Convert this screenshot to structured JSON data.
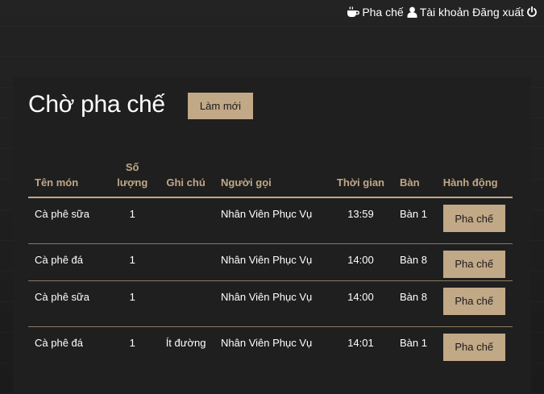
{
  "nav": {
    "barista_label": "Pha chế",
    "account_label": "Tài khoản",
    "logout_label": "Đăng xuất",
    "icons": [
      "coffee-icon",
      "user-icon",
      "power-icon"
    ]
  },
  "page": {
    "title": "Chờ pha chế",
    "refresh_label": "Làm mới"
  },
  "table": {
    "headers": {
      "item": "Tên món",
      "qty": "Số lượng",
      "note": "Ghi chú",
      "caller": "Người gọi",
      "time": "Thời gian",
      "table": "Bàn",
      "action": "Hành động"
    },
    "rows": [
      {
        "item": "Cà phê sữa",
        "qty": "1",
        "note": "",
        "caller": "Nhân Viên Phục Vụ",
        "time": "13:59",
        "table": "Bàn 1",
        "action": "Pha chế"
      },
      {
        "item": "Cà phê đá",
        "qty": "1",
        "note": "",
        "caller": "Nhân Viên Phục Vụ",
        "time": "14:00",
        "table": "Bàn 8",
        "action": "Pha chế"
      },
      {
        "item": "Cà phê sữa",
        "qty": "1",
        "note": "",
        "caller": "Nhân Viên Phục Vụ",
        "time": "14:00",
        "table": "Bàn 8",
        "action": "Pha chế"
      },
      {
        "item": "Cà phê đá",
        "qty": "1",
        "note": "Ít đường",
        "caller": "Nhân Viên Phục Vụ",
        "time": "14:01",
        "table": "Bàn 1",
        "action": "Pha chế"
      }
    ]
  },
  "colors": {
    "accent": "#c1a887",
    "background": "#202020",
    "panel": "#1f1f1f",
    "text": "#ffffff"
  }
}
